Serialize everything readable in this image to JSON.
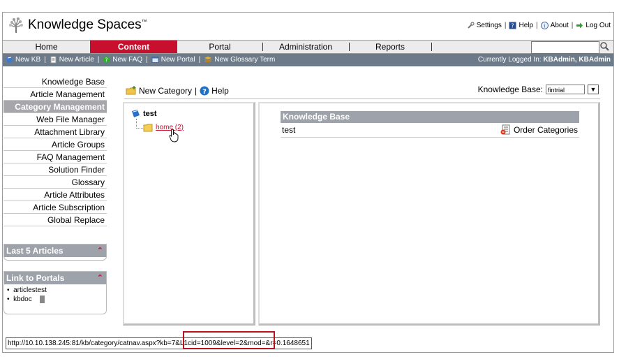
{
  "app": {
    "title": "Knowledge Spaces",
    "tm": "™"
  },
  "top_links": {
    "settings": "Settings",
    "help": "Help",
    "about": "About",
    "logout": "Log Out"
  },
  "nav": {
    "tabs": [
      "Home",
      "Content",
      "Portal",
      "Administration",
      "Reports"
    ],
    "active": "Content",
    "search_value": ""
  },
  "toolbar": {
    "items": [
      "New KB",
      "New Article",
      "New FAQ",
      "New Portal",
      "New Glossary Term"
    ],
    "logged_in_label": "Currently Logged In:",
    "logged_in_user": "KBAdmin, KBAdmin"
  },
  "sidebar": {
    "items": [
      "Knowledge Base",
      "Article Management",
      "Category Management",
      "Web File Manager",
      "Attachment Library",
      "Article Groups",
      "FAQ Management",
      "Solution Finder",
      "Glossary",
      "Article Attributes",
      "Article Subscription",
      "Global Replace"
    ],
    "active": "Category Management",
    "last5": {
      "title": "Last 5 Articles"
    },
    "portals": {
      "title": "Link to Portals",
      "items": [
        "articlestest",
        "kbdoc"
      ]
    }
  },
  "content": {
    "new_category": "New Category",
    "help": "Help",
    "kb_label": "Knowledge Base:",
    "kb_value": "fintrial",
    "tree": {
      "root": "test",
      "child": "home (2)"
    },
    "table": {
      "header": "Knowledge Base",
      "row_name": "test",
      "order_label": "Order Categories"
    }
  },
  "status_bar": {
    "url": "http://10.10.138.245:81/kb/category/catnav.aspx?kb=7&L1cid=1009&level=2&mod=&r=0.1648651"
  },
  "colors": {
    "accent": "#c8102e",
    "toolbar": "#6c7a89",
    "panel_header": "#9ea2aa"
  }
}
